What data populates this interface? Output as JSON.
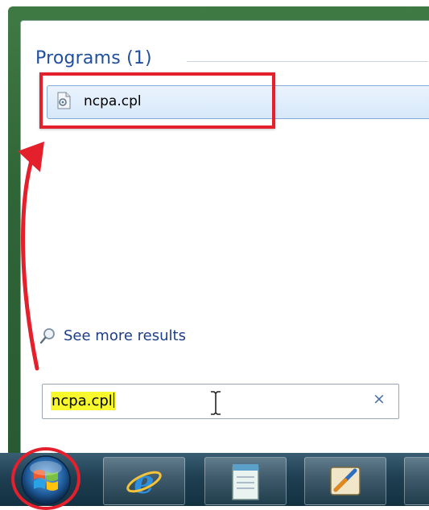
{
  "start_menu": {
    "group_title": "Programs (1)",
    "program_item": {
      "label": "ncpa.cpl",
      "icon": "control-panel-file-icon"
    },
    "see_more": {
      "label": "See more results",
      "icon": "search-icon"
    },
    "search": {
      "value": "ncpa.cpl",
      "clear_icon": "close-icon",
      "clear_glyph": "×"
    }
  },
  "taskbar": {
    "items": [
      {
        "name": "start-button",
        "icon": "windows-logo-icon"
      },
      {
        "name": "internet-explorer",
        "icon": "internet-explorer-icon"
      },
      {
        "name": "notepad",
        "icon": "notepad-icon"
      },
      {
        "name": "app",
        "icon": "app-icon"
      }
    ]
  },
  "annotations": {
    "highlight_color": "#e3202b",
    "search_highlight_color": "#f7f92c"
  }
}
